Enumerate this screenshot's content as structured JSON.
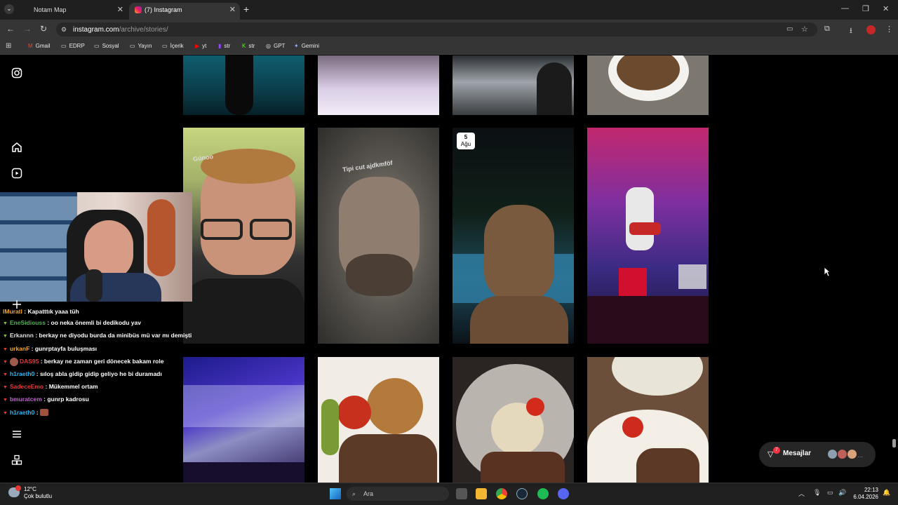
{
  "browser": {
    "tabs": [
      {
        "title": "Notam Map",
        "active": false
      },
      {
        "title": "(7) Instagram",
        "active": true
      }
    ],
    "url_host": "instagram.com",
    "url_path": "/archive/stories/",
    "bookmarks": [
      "Gmail",
      "EDRP",
      "Sosyal",
      "Yayın",
      "İçerik",
      "yt",
      "str",
      "str",
      "GPT",
      "Gemini"
    ]
  },
  "story_grid": {
    "date_badge": {
      "day": "5",
      "month": "Ağu"
    },
    "overlay_texts": [
      "Günoo",
      "Tipi cut ajdkmföf"
    ]
  },
  "chat": [
    {
      "user": "lMuratl",
      "color": "#f5a623",
      "msg": "Kapatttık yaaa tüh"
    },
    {
      "user": "EneSidiouss",
      "color": "#4caf50",
      "msg": "oo neka önemli bi dedikodu yav"
    },
    {
      "user": "Erkannn",
      "color": "#e0e0e0",
      "msg": "berkay ne diyodu burda da minibüs mü var mı demişti"
    },
    {
      "user": "urkanF",
      "color": "#f5a623",
      "msg": "gunrptayfa buluşması"
    },
    {
      "user": "DAS95",
      "color": "#e53935",
      "msg": "berkay ne zaman geri dönecek bakam role"
    },
    {
      "user": "h1raeth0",
      "color": "#29b6f6",
      "msg": "sıloş abla gidip gidip geliyo he bi duramadı"
    },
    {
      "user": "SadeceEmo",
      "color": "#e53935",
      "msg": "Mükemmel ortam"
    },
    {
      "user": "bmuratcem",
      "color": "#ba68c8",
      "msg": "gunrp kadrosu"
    },
    {
      "user": "h1raeth0",
      "color": "#29b6f6",
      "msg": ""
    }
  ],
  "messages_pill": {
    "label": "Mesajlar",
    "badge": "7"
  },
  "taskbar": {
    "weather_temp": "12°C",
    "weather_desc": "Çok bulutlu",
    "search_placeholder": "Ara",
    "time": "22:13",
    "date": "6.04.2026"
  }
}
